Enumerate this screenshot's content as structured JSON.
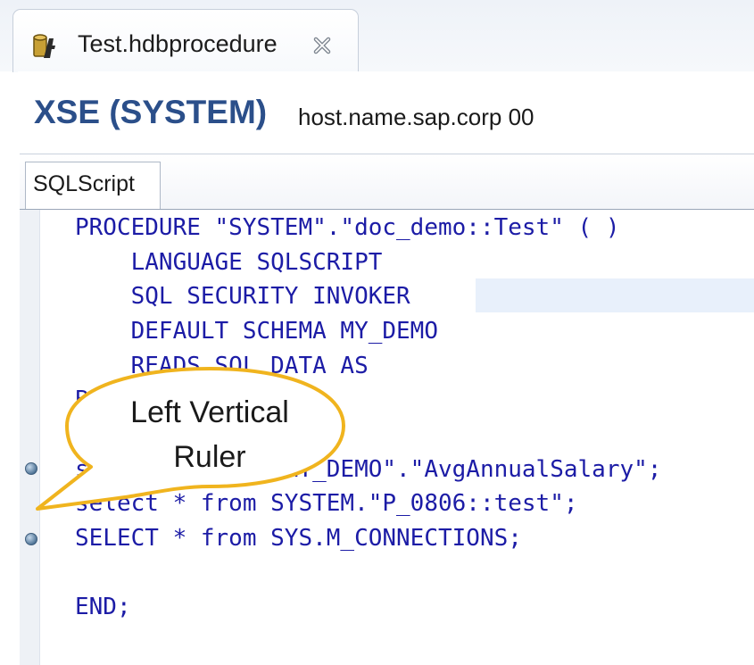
{
  "file_tab": {
    "label": "Test.hdbprocedure",
    "icon": "procedure-file-icon"
  },
  "header": {
    "system": "XSE (SYSTEM)",
    "host": "host.name.sap.corp 00"
  },
  "subtab": {
    "label": "SQLScript"
  },
  "code": {
    "lines": [
      "PROCEDURE \"SYSTEM\".\"doc_demo::Test\" ( )",
      "    LANGUAGE SQLSCRIPT",
      "    SQL SECURITY INVOKER",
      "    DEFAULT SCHEMA MY_DEMO",
      "    READS SQL DATA AS",
      "BEGIN",
      "select * from \"MY_DEMO\".\"AvgAnnualSalary\";",
      "select * from SYSTEM.\"P_0806::test\";",
      "SELECT * from SYS.M_CONNECTIONS;",
      "",
      "END;"
    ]
  },
  "callout": {
    "line1": "Left Vertical",
    "line2": "Ruler"
  },
  "colors": {
    "title": "#2b4f8a",
    "code_text": "#1c1ca6",
    "callout_border": "#f0b41e",
    "ruler_marker": "#5a7fa3",
    "line_highlight": "#e8f0fb"
  }
}
